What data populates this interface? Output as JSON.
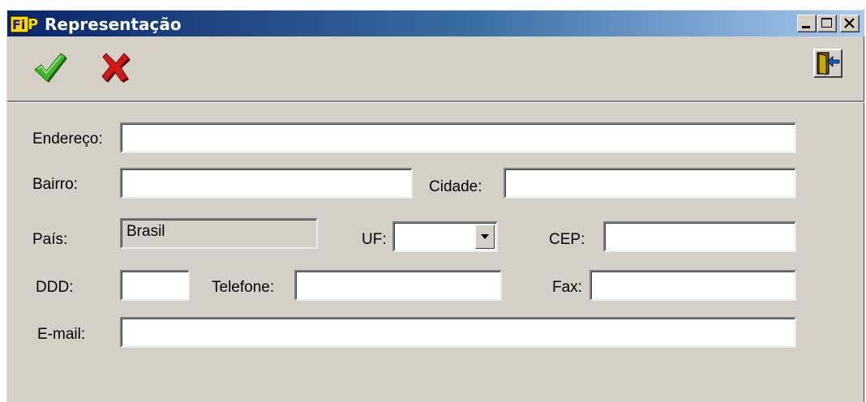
{
  "window": {
    "title": "Representação"
  },
  "form": {
    "endereco_label": "Endereço:",
    "bairro_label": "Bairro:",
    "cidade_label": "Cidade:",
    "pais_label": "País:",
    "pais_value": "Brasil",
    "uf_label": "UF:",
    "cep_label": "CEP:",
    "ddd_label": "DDD:",
    "telefone_label": "Telefone:",
    "fax_label": "Fax:",
    "email_label": "E-mail:"
  },
  "colors": {
    "titlebar_start": "#0a246a",
    "titlebar_end": "#a6caf0",
    "face": "#d4d0c8",
    "confirm": "#2e9a1a",
    "cancel": "#cc1010"
  },
  "icons": [
    "app-logo-icon",
    "minimize-icon",
    "maximize-icon",
    "close-icon",
    "confirm-checkmark-icon",
    "cancel-x-icon",
    "exit-door-icon",
    "dropdown-arrow-icon"
  ]
}
